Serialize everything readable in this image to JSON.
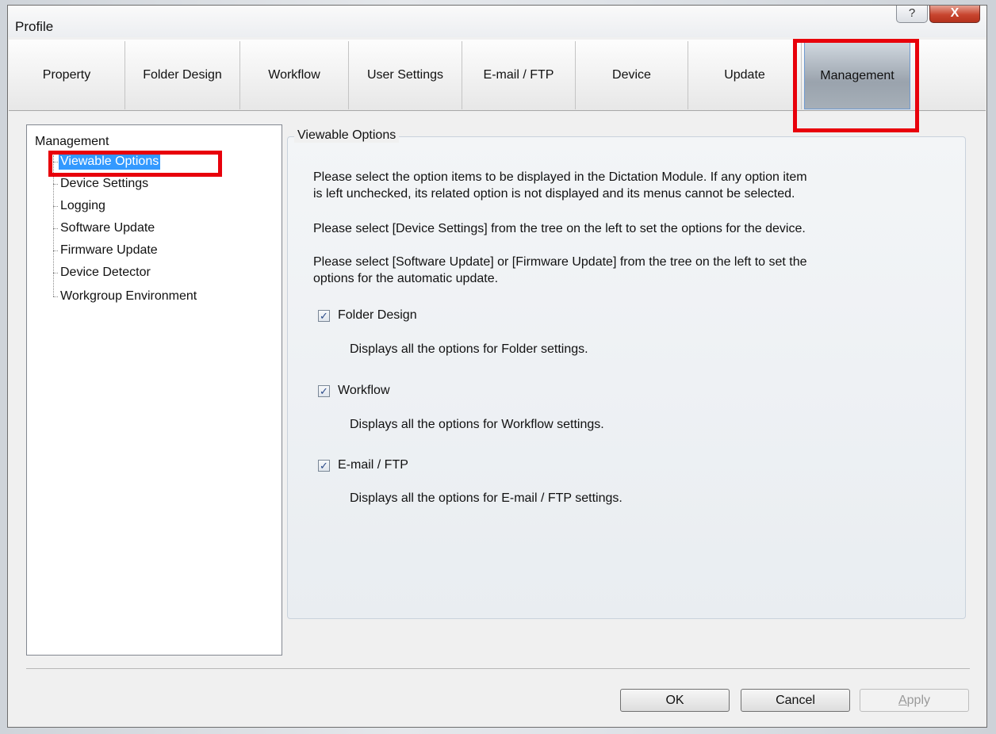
{
  "window": {
    "title": "Profile",
    "help_glyph": "?",
    "close_glyph": "X"
  },
  "tabs": [
    {
      "label": "Property"
    },
    {
      "label": "Folder Design"
    },
    {
      "label": "Workflow"
    },
    {
      "label": "User Settings"
    },
    {
      "label": "E-mail / FTP"
    },
    {
      "label": "Device"
    },
    {
      "label": "Update"
    },
    {
      "label": "Management",
      "active": true
    }
  ],
  "tree": {
    "root": "Management",
    "items": [
      {
        "label": "Viewable Options",
        "selected": true
      },
      {
        "label": "Device Settings"
      },
      {
        "label": "Logging"
      },
      {
        "label": "Software Update"
      },
      {
        "label": "Firmware Update"
      },
      {
        "label": "Device Detector"
      },
      {
        "label": "Workgroup Environment"
      }
    ]
  },
  "panel": {
    "legend": "Viewable Options",
    "para1_line1": "Please select the option items to be displayed in the Dictation Module. If any option item",
    "para1_line2": "is left unchecked, its related option is not displayed and its menus cannot be selected.",
    "para2": "Please select [Device Settings] from the tree on the left to set the options for the device.",
    "para3_line1": "Please select [Software Update] or [Firmware Update] from the tree on the left to set the",
    "para3_line2": "options for the automatic update.",
    "options": [
      {
        "label": "Folder Design",
        "checked": true,
        "description": "Displays all the options for Folder settings."
      },
      {
        "label": "Workflow",
        "checked": true,
        "description": "Displays all the options for Workflow settings."
      },
      {
        "label": "E-mail / FTP",
        "checked": true,
        "description": "Displays all the options for E-mail / FTP settings."
      }
    ],
    "check_glyph": "✓"
  },
  "buttons": {
    "ok": "OK",
    "cancel": "Cancel",
    "apply_accel": "A",
    "apply_rest": "pply"
  },
  "colors": {
    "highlight_box": "#e8000b",
    "selection": "#3399ff",
    "active_tab_border": "#6f9ad0"
  }
}
